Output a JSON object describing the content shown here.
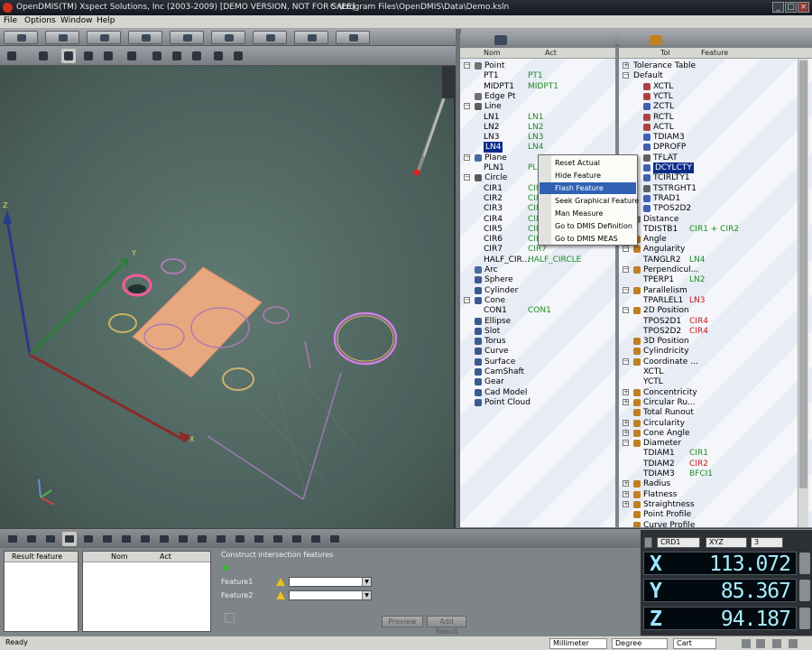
{
  "window": {
    "title": "OpenDMIS(TM) Xspect Solutions, Inc (2003-2009) [DEMO VERSION, NOT FOR SALE]",
    "path": "C:\\Program Files\\OpenDMIS\\Data\\Demo.ksln",
    "minimize": "_",
    "maximize": "□",
    "close": "×"
  },
  "menu": [
    "File",
    "Options",
    "Window",
    "Help"
  ],
  "viewport": {
    "axis_z": "Z",
    "axis_y": "Y",
    "axis_x": "X"
  },
  "features_panel": {
    "col_nom": "Nom",
    "col_act": "Act",
    "rows": [
      {
        "level": 0,
        "label": "Point",
        "act": "",
        "expand": "−",
        "icon": "point-icon",
        "color": "#707070"
      },
      {
        "level": 1,
        "label": "PT1",
        "act": "PT1"
      },
      {
        "level": 1,
        "label": "MIDPT1",
        "act": "MIDPT1"
      },
      {
        "level": 0,
        "label": "Edge Pt",
        "act": "",
        "icon": "edge-point-icon",
        "color": "#707070"
      },
      {
        "level": 0,
        "label": "Line",
        "act": "",
        "expand": "−",
        "icon": "line-icon",
        "color": "#606060"
      },
      {
        "level": 1,
        "label": "LN1",
        "act": "LN1"
      },
      {
        "level": 1,
        "label": "LN2",
        "act": "LN2"
      },
      {
        "level": 1,
        "label": "LN3",
        "act": "LN3"
      },
      {
        "level": 1,
        "label": "LN4",
        "act": "LN4",
        "selected": true
      },
      {
        "level": 0,
        "label": "Plane",
        "act": "",
        "expand": "−",
        "icon": "plane-icon",
        "color": "#4a6aa0"
      },
      {
        "level": 1,
        "label": "PLN1",
        "act": "PLN1"
      },
      {
        "level": 0,
        "label": "Circle",
        "act": "",
        "expand": "−",
        "icon": "circle-icon",
        "color": "#5a5a5a"
      },
      {
        "level": 1,
        "label": "CIR1",
        "act": "CIR1"
      },
      {
        "level": 1,
        "label": "CIR2",
        "act": "CIR2"
      },
      {
        "level": 1,
        "label": "CIR3",
        "act": "CIR3"
      },
      {
        "level": 1,
        "label": "CIR4",
        "act": "CIR4"
      },
      {
        "level": 1,
        "label": "CIR5",
        "act": "CIR5"
      },
      {
        "level": 1,
        "label": "CIR6",
        "act": "CIR6"
      },
      {
        "level": 1,
        "label": "CIR7",
        "act": "CIR7"
      },
      {
        "level": 1,
        "label": "HALF_CIR...",
        "act": "HALF_CIRCLE"
      },
      {
        "level": 0,
        "label": "Arc",
        "act": "",
        "icon": "arc-icon",
        "color": "#4a6aa0"
      },
      {
        "level": 0,
        "label": "Sphere",
        "act": "",
        "icon": "sphere-icon",
        "color": "#3a5a90"
      },
      {
        "level": 0,
        "label": "Cylinder",
        "act": "",
        "icon": "cylinder-icon",
        "color": "#3a5a90"
      },
      {
        "level": 0,
        "label": "Cone",
        "act": "",
        "expand": "−",
        "icon": "cone-icon",
        "color": "#3a5a90"
      },
      {
        "level": 1,
        "label": "CON1",
        "act": "CON1"
      },
      {
        "level": 0,
        "label": "Ellipse",
        "act": "",
        "icon": "ellipse-icon",
        "color": "#3a5a90"
      },
      {
        "level": 0,
        "label": "Slot",
        "act": "",
        "icon": "slot-icon",
        "color": "#3a5a90"
      },
      {
        "level": 0,
        "label": "Torus",
        "act": "",
        "icon": "torus-icon",
        "color": "#3a5a90"
      },
      {
        "level": 0,
        "label": "Curve",
        "act": "",
        "icon": "curve-icon",
        "color": "#3a5a90"
      },
      {
        "level": 0,
        "label": "Surface",
        "act": "",
        "icon": "surface-icon",
        "color": "#3a5a90"
      },
      {
        "level": 0,
        "label": "CamShaft",
        "act": "",
        "icon": "camshaft-icon",
        "color": "#3a5a90"
      },
      {
        "level": 0,
        "label": "Gear",
        "act": "",
        "icon": "gear-icon",
        "color": "#3a5a90"
      },
      {
        "level": 0,
        "label": "Cad Model",
        "act": "",
        "icon": "cad-model-icon",
        "color": "#3a5a90"
      },
      {
        "level": 0,
        "label": "Point Cloud",
        "act": "",
        "icon": "point-cloud-icon",
        "color": "#3a5a90"
      }
    ]
  },
  "context_menu": {
    "items": [
      {
        "label": "Reset Actual"
      },
      {
        "label": "Hide Feature"
      },
      {
        "label": "Flash Feature",
        "highlighted": true
      },
      {
        "label": "Seek Graphical Feature"
      },
      {
        "label": "Man Measure"
      },
      {
        "label": "Go to DMIS Definition"
      },
      {
        "label": "Go to DMIS MEAS"
      }
    ]
  },
  "tolerance_panel": {
    "col_tol": "Tol",
    "col_feature": "Feature",
    "rows": [
      {
        "level": 0,
        "label": "Tolerance Table",
        "feature": "",
        "expand": "+"
      },
      {
        "level": 0,
        "label": "Default",
        "feature": "",
        "expand": "−"
      },
      {
        "level": 1,
        "label": "XCTL",
        "feature": "",
        "icon": "xctl-icon",
        "color": "#b04040"
      },
      {
        "level": 1,
        "label": "YCTL",
        "feature": "",
        "icon": "yctl-icon",
        "color": "#b04040"
      },
      {
        "level": 1,
        "label": "ZCTL",
        "feature": "",
        "icon": "zctl-icon",
        "color": "#4060b0"
      },
      {
        "level": 1,
        "label": "RCTL",
        "feature": "",
        "icon": "rctl-icon",
        "color": "#b04040"
      },
      {
        "level": 1,
        "label": "ACTL",
        "feature": "",
        "icon": "actl-icon",
        "color": "#b04040"
      },
      {
        "level": 1,
        "label": "TDIAM3",
        "feature": "",
        "icon": "diameter-icon",
        "color": "#4060b0"
      },
      {
        "level": 1,
        "label": "DPROFP",
        "feature": "",
        "icon": "profile-icon",
        "color": "#4060b0"
      },
      {
        "level": 1,
        "label": "TFLAT",
        "feature": "",
        "icon": "flatness-icon",
        "color": "#606060"
      },
      {
        "level": 1,
        "label": "DCYLCTY",
        "feature": "",
        "icon": "cylindricity-icon",
        "color": "#4060b0",
        "selected": true
      },
      {
        "level": 1,
        "label": "TCIRLTY1",
        "feature": "",
        "icon": "circularity-icon",
        "color": "#4060b0"
      },
      {
        "level": 1,
        "label": "TSTRGHT1",
        "feature": "",
        "icon": "straightness-icon",
        "color": "#606060"
      },
      {
        "level": 1,
        "label": "TRAD1",
        "feature": "",
        "icon": "radius-icon",
        "color": "#4060b0"
      },
      {
        "level": 1,
        "label": "TPOS2D2",
        "feature": "",
        "icon": "position-icon",
        "color": "#4060b0"
      },
      {
        "level": 0,
        "label": "Distance",
        "feature": "",
        "expand": "−",
        "icon": "distance-icon",
        "color": "#808080"
      },
      {
        "level": 1,
        "label": "TDISTB1",
        "feature": "CIR1 + CIR2"
      },
      {
        "level": 0,
        "label": "Angle",
        "feature": "",
        "expand": "+",
        "icon": "angle-icon",
        "color": "#c08020"
      },
      {
        "level": 0,
        "label": "Angularity",
        "feature": "",
        "expand": "−",
        "icon": "angularity-icon",
        "color": "#c08020"
      },
      {
        "level": 1,
        "label": "TANGLR2",
        "feature": "LN4"
      },
      {
        "level": 0,
        "label": "Perpendicul...",
        "feature": "",
        "expand": "−",
        "icon": "perpendicularity-icon",
        "color": "#c08020"
      },
      {
        "level": 1,
        "label": "TPERP1",
        "feature": "LN2"
      },
      {
        "level": 0,
        "label": "Parallelism",
        "feature": "",
        "expand": "−",
        "icon": "parallelism-icon",
        "color": "#c08020"
      },
      {
        "level": 1,
        "label": "TPARLEL1",
        "feature": "LN3",
        "red": true
      },
      {
        "level": 0,
        "label": "2D Position",
        "feature": "",
        "expand": "−",
        "icon": "position-2d-icon",
        "color": "#c08020"
      },
      {
        "level": 1,
        "label": "TPOS2D1",
        "feature": "CIR4",
        "red": true
      },
      {
        "level": 1,
        "label": "TPOS2D2",
        "feature": "CIR4",
        "red": true
      },
      {
        "level": 0,
        "label": "3D Position",
        "feature": "",
        "icon": "position-3d-icon",
        "color": "#c08020"
      },
      {
        "level": 0,
        "label": "Cylindricity",
        "feature": "",
        "icon": "cylindricity-icon",
        "color": "#c08020"
      },
      {
        "level": 0,
        "label": "Coordinate ...",
        "feature": "",
        "expand": "−",
        "icon": "coordinate-icon",
        "color": "#c08020"
      },
      {
        "level": 1,
        "label": "XCTL",
        "feature": ""
      },
      {
        "level": 1,
        "label": "YCTL",
        "feature": ""
      },
      {
        "level": 0,
        "label": "Concentricity",
        "feature": "",
        "expand": "+",
        "icon": "concentricity-icon",
        "color": "#c08020"
      },
      {
        "level": 0,
        "label": "Circular Ru...",
        "feature": "",
        "expand": "+",
        "icon": "circular-runout-icon",
        "color": "#c08020"
      },
      {
        "level": 0,
        "label": "Total Runout",
        "feature": "",
        "icon": "total-runout-icon",
        "color": "#c08020"
      },
      {
        "level": 0,
        "label": "Circularity",
        "feature": "",
        "expand": "+",
        "icon": "circularity-icon",
        "color": "#c08020"
      },
      {
        "level": 0,
        "label": "Cone Angle",
        "feature": "",
        "expand": "+",
        "icon": "cone-angle-icon",
        "color": "#c08020"
      },
      {
        "level": 0,
        "label": "Diameter",
        "feature": "",
        "expand": "−",
        "icon": "diameter-icon",
        "color": "#c08020"
      },
      {
        "level": 1,
        "label": "TDIAM1",
        "feature": "CIR1"
      },
      {
        "level": 1,
        "label": "TDIAM2",
        "feature": "CIR2",
        "red": true
      },
      {
        "level": 1,
        "label": "TDIAM3",
        "feature": "BFCI1"
      },
      {
        "level": 0,
        "label": "Radius",
        "feature": "",
        "expand": "+",
        "icon": "radius-icon",
        "color": "#c08020"
      },
      {
        "level": 0,
        "label": "Flatness",
        "feature": "",
        "expand": "+",
        "icon": "flatness-icon",
        "color": "#c08020"
      },
      {
        "level": 0,
        "label": "Straightness",
        "feature": "",
        "expand": "+",
        "icon": "straightness-icon",
        "color": "#c08020"
      },
      {
        "level": 0,
        "label": "Point Profile",
        "feature": "",
        "icon": "point-profile-icon",
        "color": "#c08020"
      },
      {
        "level": 0,
        "label": "Curve Profile",
        "feature": "",
        "icon": "curve-profile-icon",
        "color": "#c08020"
      }
    ]
  },
  "bottom": {
    "result_list": {
      "col_result": "Result feature"
    },
    "nom_act_list": {
      "col_nom": "Nom",
      "col_act": "Act"
    },
    "command": {
      "title": "Construct intersection features",
      "feature1_label": "Feature1",
      "feature2_label": "Feature2",
      "feature1_value": "",
      "feature2_value": "",
      "preview_button": "Preview",
      "add_result_button": "Add Result"
    }
  },
  "dro": {
    "coord_system": "CRD1",
    "mode": "XYZ",
    "decimals": "3",
    "x_label": "X",
    "x_value": "113.072",
    "y_label": "Y",
    "y_value": "85.367",
    "z_label": "Z",
    "z_value": "94.187"
  },
  "status": {
    "text": "Ready",
    "units": "Millimeter",
    "angle_units": "Degree",
    "coord_type": "Cart"
  },
  "colors": {
    "selection": "#0a2c8c",
    "highlight": "#3062b4",
    "actual_text": "#1d8a22",
    "out_of_tol": "#c01818",
    "dro_text": "#a8eeff"
  }
}
